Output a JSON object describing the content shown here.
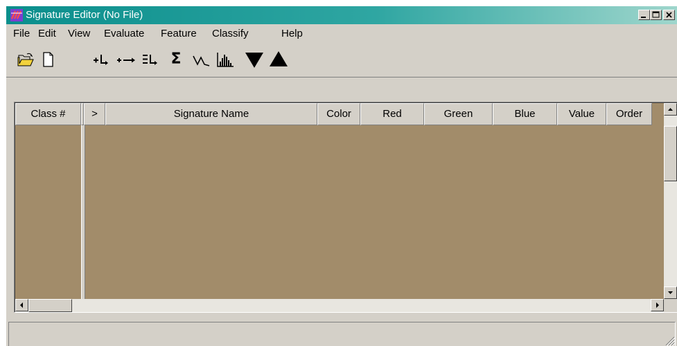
{
  "window": {
    "title": "Signature Editor (No File)"
  },
  "menu": [
    "File",
    "Edit",
    "View",
    "Evaluate",
    "Feature",
    "Classify",
    "Help"
  ],
  "toolbar": {
    "icons": [
      "open-folder-icon",
      "new-file-icon",
      "add-row-icon",
      "link-icon",
      "merge-rows-icon",
      "sigma-icon",
      "line-plot-icon",
      "histogram-icon",
      "triangle-down-icon",
      "triangle-up-icon"
    ],
    "sigma_glyph": "Σ"
  },
  "grid": {
    "columns": [
      "Class #",
      ">",
      "Signature Name",
      "Color",
      "Red",
      "Green",
      "Blue",
      "Value",
      "Order"
    ],
    "rows": []
  },
  "statusbar": {
    "text": ""
  },
  "colors": {
    "grid_background": "#a28c6a",
    "chrome": "#d4d0c8",
    "titlebar": "#0a8e8c"
  }
}
